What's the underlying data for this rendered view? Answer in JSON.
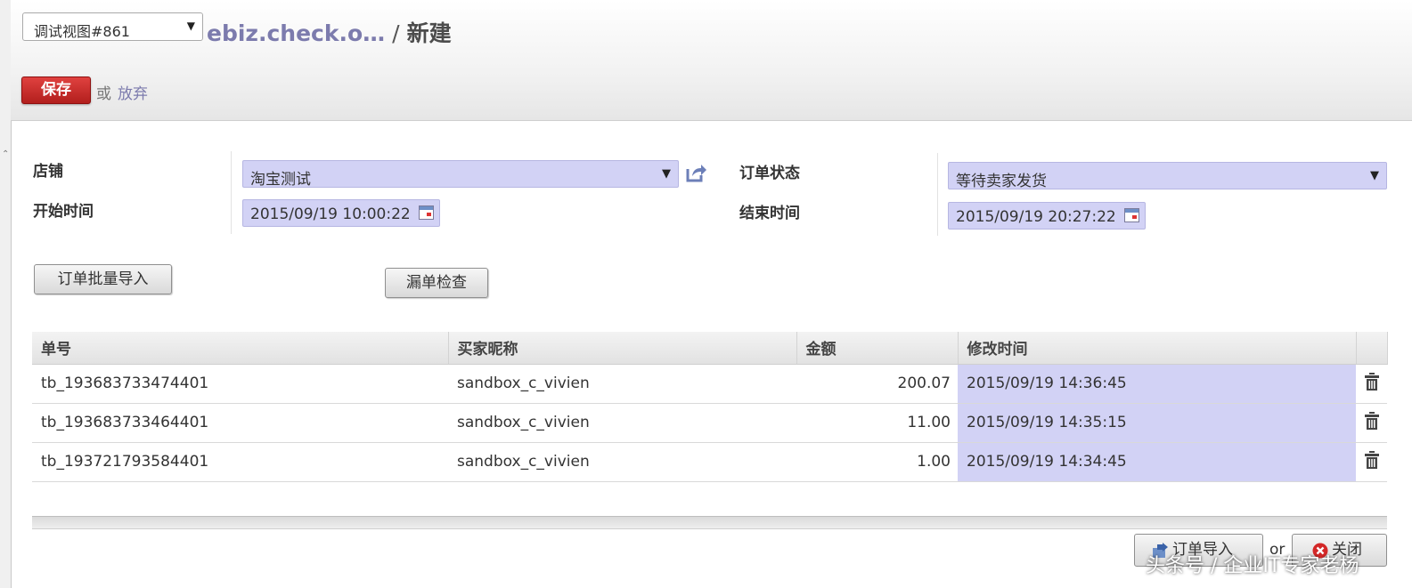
{
  "header": {
    "view_select": "调试视图#861",
    "breadcrumb_link": "ebiz.check.o…",
    "breadcrumb_sep": "/",
    "breadcrumb_current": "新建",
    "save_label": "保存",
    "or_label": "或",
    "discard_label": "放弃"
  },
  "form": {
    "shop_label": "店铺",
    "shop_value": "淘宝测试",
    "status_label": "订单状态",
    "status_value": "等待卖家发货",
    "start_label": "开始时间",
    "start_value": "2015/09/19 10:00:22",
    "end_label": "结束时间",
    "end_value": "2015/09/19 20:27:22"
  },
  "actions": {
    "batch_import_label": "订单批量导入",
    "missing_check_label": "漏单检查"
  },
  "table": {
    "columns": [
      "单号",
      "买家昵称",
      "金额",
      "修改时间"
    ],
    "rows": [
      {
        "order_no": "tb_193683733474401",
        "buyer": "sandbox_c_vivien",
        "amount": "200.07",
        "modified": "2015/09/19 14:36:45"
      },
      {
        "order_no": "tb_193683733464401",
        "buyer": "sandbox_c_vivien",
        "amount": "11.00",
        "modified": "2015/09/19 14:35:15"
      },
      {
        "order_no": "tb_193721793584401",
        "buyer": "sandbox_c_vivien",
        "amount": "1.00",
        "modified": "2015/09/19 14:34:45"
      }
    ]
  },
  "footer": {
    "import_label": "订单导入",
    "or_label": "or",
    "close_label": "关闭"
  },
  "watermark": "头条号 / 企业IT专家老杨",
  "colors": {
    "accent": "#7c7bad",
    "save_button": "#c62a28",
    "field_fill": "#d2d2f5"
  },
  "icons": [
    "dropdown-arrow-icon",
    "external-link-icon",
    "calendar-icon",
    "trash-icon",
    "import-icon",
    "close-icon"
  ]
}
